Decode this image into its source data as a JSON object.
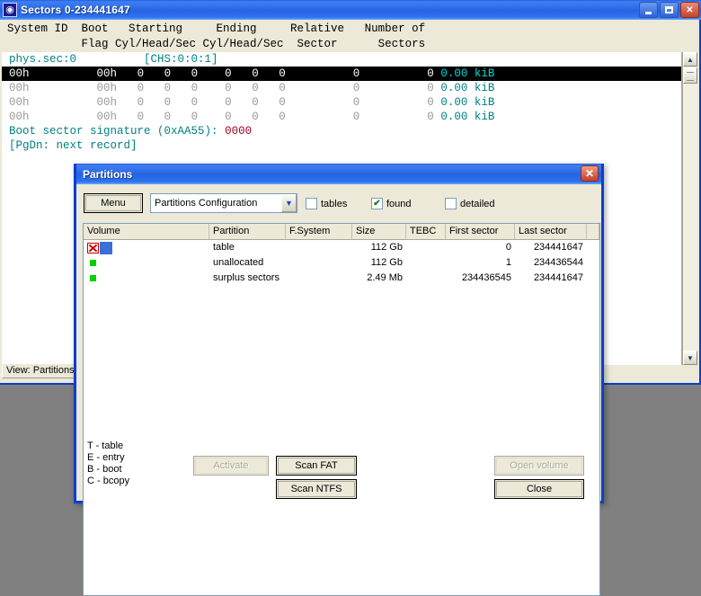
{
  "main_window": {
    "title": "Sectors 0-234441647",
    "title_icon": "disk-platter-icon",
    "controls": {
      "minimize": "minimize-icon",
      "maximize": "maximize-icon",
      "close": "close-icon"
    },
    "column_header_line1": "System ID  Boot   Starting     Ending     Relative   Number of",
    "column_header_line2": "           Flag Cyl/Head/Sec Cyl/Head/Sec  Sector      Sectors",
    "status": "View: Partitions",
    "console": {
      "sector_line": "phys.sec:0          [CHS:0:0:1]",
      "rows": [
        {
          "system_id": "00h",
          "boot_flag": "00h",
          "start_cyl": "0",
          "start_head": "0",
          "start_sec": "0",
          "end_cyl": "0",
          "end_head": "0",
          "end_sec": "0",
          "relative_sector": "0",
          "number_of_sectors": "0",
          "size": "0.00 kiB",
          "selected": true
        },
        {
          "system_id": "00h",
          "boot_flag": "00h",
          "start_cyl": "0",
          "start_head": "0",
          "start_sec": "0",
          "end_cyl": "0",
          "end_head": "0",
          "end_sec": "0",
          "relative_sector": "0",
          "number_of_sectors": "0",
          "size": "0.00 kiB",
          "selected": false
        },
        {
          "system_id": "00h",
          "boot_flag": "00h",
          "start_cyl": "0",
          "start_head": "0",
          "start_sec": "0",
          "end_cyl": "0",
          "end_head": "0",
          "end_sec": "0",
          "relative_sector": "0",
          "number_of_sectors": "0",
          "size": "0.00 kiB",
          "selected": false
        },
        {
          "system_id": "00h",
          "boot_flag": "00h",
          "start_cyl": "0",
          "start_head": "0",
          "start_sec": "0",
          "end_cyl": "0",
          "end_head": "0",
          "end_sec": "0",
          "relative_sector": "0",
          "number_of_sectors": "0",
          "size": "0.00 kiB",
          "selected": false
        }
      ],
      "signature_label": "Boot sector signature (0xAA55):",
      "signature_value": "0000",
      "hint": "[PgDn: next record]"
    },
    "scrollbar": {
      "up": "scroll-up-arrow-icon",
      "down": "scroll-down-arrow-icon"
    }
  },
  "dialog": {
    "title": "Partitions",
    "close_label": "✕",
    "toolbar": {
      "menu_label": "Menu",
      "config_value": "Partitions Configuration",
      "chevron": "chevron-down-icon",
      "checkboxes": [
        {
          "label": "tables",
          "checked": false,
          "mark": ""
        },
        {
          "label": "found",
          "checked": true,
          "mark": "✔"
        },
        {
          "label": "detailed",
          "checked": false,
          "mark": ""
        }
      ]
    },
    "list": {
      "columns": [
        "Volume",
        "Partition",
        "F.System",
        "Size",
        "TEBC",
        "First sector",
        "Last sector"
      ],
      "rows": [
        {
          "icon": "red-x-icon",
          "volume": "",
          "partition": "table",
          "fsystem": "",
          "size": "112 Gb",
          "tebc": "",
          "first_sector": "0",
          "last_sector": "234441647",
          "selected": true
        },
        {
          "icon": "green-square-icon",
          "volume": "",
          "partition": "unallocated",
          "fsystem": "",
          "size": "112 Gb",
          "tebc": "",
          "first_sector": "1",
          "last_sector": "234436544",
          "selected": false
        },
        {
          "icon": "green-square-icon",
          "volume": "",
          "partition": "surplus sectors",
          "fsystem": "",
          "size": "2.49 Mb",
          "tebc": "",
          "first_sector": "234436545",
          "last_sector": "234441647",
          "selected": false
        }
      ]
    },
    "legend": [
      "T - table",
      "E - entry",
      "B - boot",
      "C - bcopy"
    ],
    "buttons": {
      "activate": "Activate",
      "scan_fat": "Scan FAT",
      "scan_ntfs": "Scan NTFS",
      "open_volume": "Open volume",
      "close": "Close"
    }
  }
}
